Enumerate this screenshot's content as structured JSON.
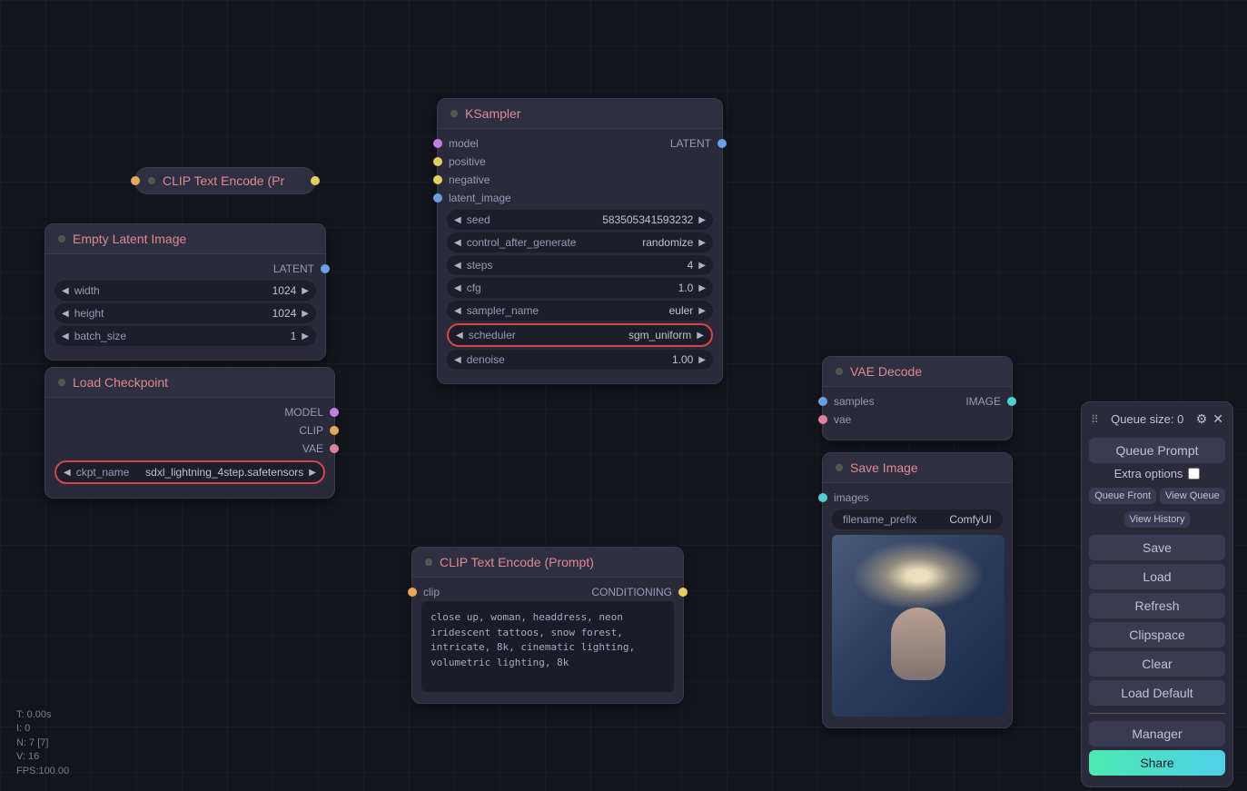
{
  "nodes": {
    "clip_collapsed": {
      "title": "CLIP Text Encode (Pr"
    },
    "empty_latent": {
      "title": "Empty Latent Image",
      "out_latent": "LATENT",
      "widgets": {
        "width": {
          "label": "width",
          "value": "1024"
        },
        "height": {
          "label": "height",
          "value": "1024"
        },
        "batch": {
          "label": "batch_size",
          "value": "1"
        }
      }
    },
    "load_ckpt": {
      "title": "Load Checkpoint",
      "out_model": "MODEL",
      "out_clip": "CLIP",
      "out_vae": "VAE",
      "widget": {
        "label": "ckpt_name",
        "value": "sdxl_lightning_4step.safetensors"
      }
    },
    "ksampler": {
      "title": "KSampler",
      "in_model": "model",
      "in_positive": "positive",
      "in_negative": "negative",
      "in_latent": "latent_image",
      "out_latent": "LATENT",
      "widgets": {
        "seed": {
          "label": "seed",
          "value": "583505341593232"
        },
        "ctrl": {
          "label": "control_after_generate",
          "value": "randomize"
        },
        "steps": {
          "label": "steps",
          "value": "4"
        },
        "cfg": {
          "label": "cfg",
          "value": "1.0"
        },
        "sampler": {
          "label": "sampler_name",
          "value": "euler"
        },
        "scheduler": {
          "label": "scheduler",
          "value": "sgm_uniform"
        },
        "denoise": {
          "label": "denoise",
          "value": "1.00"
        }
      }
    },
    "clip_prompt": {
      "title": "CLIP Text Encode (Prompt)",
      "in_clip": "clip",
      "out_cond": "CONDITIONING",
      "text": "close up, woman, headdress, neon iridescent tattoos, snow forest, intricate, 8k, cinematic lighting, volumetric lighting, 8k"
    },
    "vae_decode": {
      "title": "VAE Decode",
      "in_samples": "samples",
      "in_vae": "vae",
      "out_image": "IMAGE"
    },
    "save_image": {
      "title": "Save Image",
      "in_images": "images",
      "widget": {
        "label": "filename_prefix",
        "value": "ComfyUI"
      }
    }
  },
  "panel": {
    "queue_label": "Queue size: 0",
    "queue_prompt": "Queue Prompt",
    "extra_options": "Extra options",
    "queue_front": "Queue Front",
    "view_queue": "View Queue",
    "view_history": "View History",
    "save": "Save",
    "load": "Load",
    "refresh": "Refresh",
    "clipspace": "Clipspace",
    "clear": "Clear",
    "load_default": "Load Default",
    "manager": "Manager",
    "share": "Share"
  },
  "stats": {
    "t": "T: 0.00s",
    "i": "I: 0",
    "n": "N: 7 [7]",
    "v": "V: 16",
    "fps": "FPS:100.00"
  }
}
